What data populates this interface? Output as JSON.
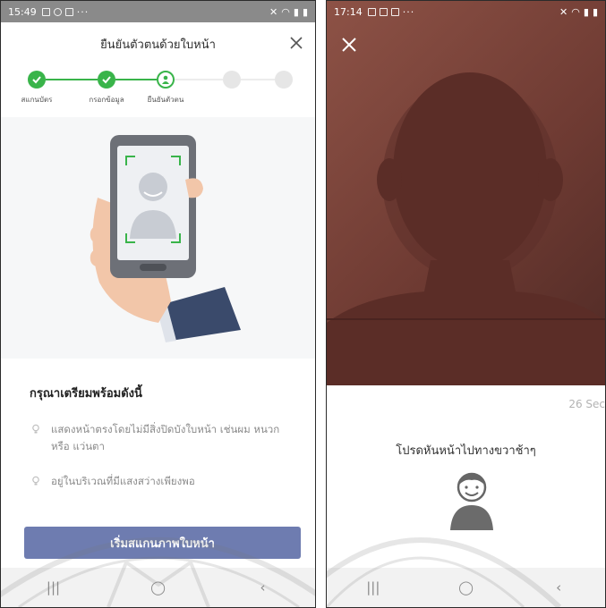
{
  "left": {
    "status": {
      "time": "15:49"
    },
    "header": {
      "title": "ยืนยันตัวตนด้วยใบหน้า"
    },
    "steps": [
      {
        "label": "สแกนบัตร",
        "state": "done"
      },
      {
        "label": "กรอกข้อมูล",
        "state": "done"
      },
      {
        "label": "ยืนยันตัวตน",
        "state": "current"
      },
      {
        "label": "",
        "state": "future"
      },
      {
        "label": "",
        "state": "future"
      }
    ],
    "prep": {
      "title": "กรุณาเตรียมพร้อมดังนี้",
      "items": [
        "แสดงหน้าตรงโดยไม่มีสิ่งปิดบังใบหน้า เช่นผม หนวก หรือ แว่นตา",
        "อยู่ในบริเวณที่มีแสงสว่างเพียงพอ"
      ]
    },
    "start_button": "เริ่มสแกนภาพใบหน้า",
    "nav": {
      "recent": "|||",
      "home": "◯",
      "back": "‹"
    }
  },
  "right": {
    "status": {
      "time": "17:14"
    },
    "timer": "26 Sec",
    "instruction": "โปรดหันหน้าไปทางขวาช้าๆ",
    "nav": {
      "recent": "|||",
      "home": "◯",
      "back": "‹"
    }
  },
  "colors": {
    "accent_green": "#39b44a",
    "button_blue": "#6e7cb0",
    "camera_bg": "#7a4339",
    "silhouette": "#5c2f29"
  }
}
